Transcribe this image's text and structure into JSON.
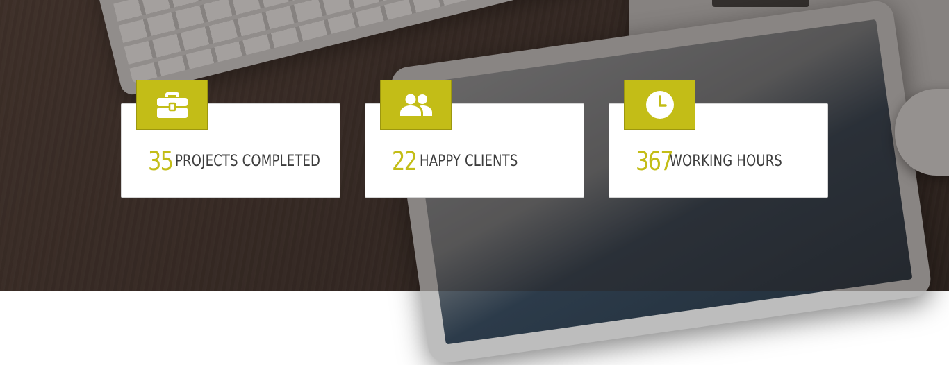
{
  "stats": [
    {
      "value": "35",
      "label": "PROJECTS COMPLETED",
      "icon": "briefcase-icon"
    },
    {
      "value": "22",
      "label": "HAPPY CLIENTS",
      "icon": "users-icon"
    },
    {
      "value": "367",
      "label": "WORKING HOURS",
      "icon": "clock-icon"
    }
  ],
  "colors": {
    "accent": "#c3bd17",
    "card_background": "#ffffff",
    "label_text": "#3d3d3d"
  }
}
